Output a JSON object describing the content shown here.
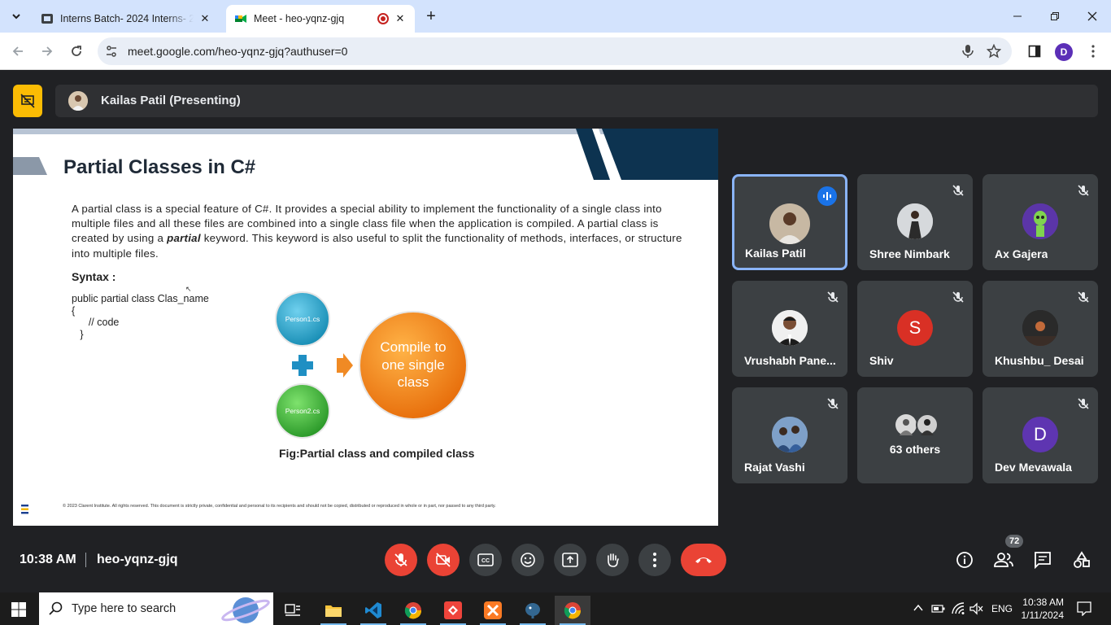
{
  "browser": {
    "tabs": [
      {
        "title": "Interns Batch- 2024 Interns- 20..."
      },
      {
        "title": "Meet - heo-yqnz-gjq"
      }
    ],
    "url": "meet.google.com/heo-yqnz-gjq?authuser=0",
    "profile_initial": "D"
  },
  "meet": {
    "presenter": "Kailas Patil (Presenting)",
    "time": "10:38 AM",
    "meeting_code": "heo-yqnz-gjq",
    "participant_count": "72",
    "participants": [
      {
        "name": "Kailas Patil",
        "speaking": true
      },
      {
        "name": "Shree Nimbark",
        "muted": true
      },
      {
        "name": "Ax Gajera",
        "muted": true
      },
      {
        "name": "Vrushabh Pane...",
        "muted": true
      },
      {
        "name": "Shiv",
        "initial": "S",
        "avatar_color": "#d93025",
        "muted": true
      },
      {
        "name": "Khushbu_ Desai",
        "muted": true
      },
      {
        "name": "Rajat Vashi",
        "muted": true
      },
      {
        "name": "63 others"
      },
      {
        "name": "Dev Mevawala",
        "initial": "D",
        "avatar_color": "#5e35b1",
        "muted": true
      }
    ]
  },
  "slide": {
    "title": "Partial Classes in C#",
    "para_1": "A partial class is a special feature of C#. It provides a special ability to implement the functionality of a single class into multiple files and all these files are combined into a single class file when the application is compiled. A partial class is created by using a ",
    "para_keyword": "partial",
    "para_2": " keyword. This keyword is also useful to split the functionality of methods, interfaces, or structure into multiple files.",
    "syntax_label": "Syntax :",
    "code_line_1": "public partial class Clas_name",
    "code_line_2": "{",
    "code_line_3": "      // code",
    "code_line_4": "   }",
    "file_1": "Person1.cs",
    "file_2": "Person2.cs",
    "compile_text_1": "Compile to",
    "compile_text_2": "one single",
    "compile_text_3": "class",
    "caption": "Fig:Partial class and compiled class",
    "footer": "© 2023 Clarent Institute. All rights reserved. This document is strictly private, confidential and personal to its recipients and should not be copied, distributed or reproduced in whole or in part, nor passed to any third party."
  },
  "taskbar": {
    "search_placeholder": "Type here to search",
    "language": "ENG",
    "time": "10:38 AM",
    "date": "1/11/2024"
  }
}
